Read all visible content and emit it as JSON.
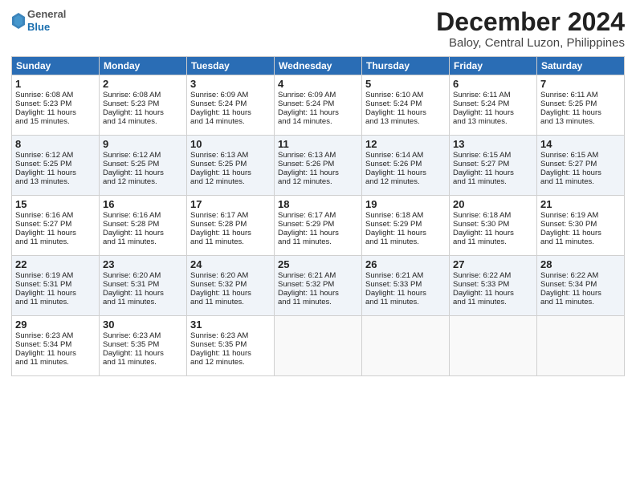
{
  "header": {
    "logo_general": "General",
    "logo_blue": "Blue",
    "month_title": "December 2024",
    "location": "Baloy, Central Luzon, Philippines"
  },
  "weekdays": [
    "Sunday",
    "Monday",
    "Tuesday",
    "Wednesday",
    "Thursday",
    "Friday",
    "Saturday"
  ],
  "rows": [
    [
      {
        "day": "1",
        "lines": [
          "Sunrise: 6:08 AM",
          "Sunset: 5:23 PM",
          "Daylight: 11 hours",
          "and 15 minutes."
        ]
      },
      {
        "day": "2",
        "lines": [
          "Sunrise: 6:08 AM",
          "Sunset: 5:23 PM",
          "Daylight: 11 hours",
          "and 14 minutes."
        ]
      },
      {
        "day": "3",
        "lines": [
          "Sunrise: 6:09 AM",
          "Sunset: 5:24 PM",
          "Daylight: 11 hours",
          "and 14 minutes."
        ]
      },
      {
        "day": "4",
        "lines": [
          "Sunrise: 6:09 AM",
          "Sunset: 5:24 PM",
          "Daylight: 11 hours",
          "and 14 minutes."
        ]
      },
      {
        "day": "5",
        "lines": [
          "Sunrise: 6:10 AM",
          "Sunset: 5:24 PM",
          "Daylight: 11 hours",
          "and 13 minutes."
        ]
      },
      {
        "day": "6",
        "lines": [
          "Sunrise: 6:11 AM",
          "Sunset: 5:24 PM",
          "Daylight: 11 hours",
          "and 13 minutes."
        ]
      },
      {
        "day": "7",
        "lines": [
          "Sunrise: 6:11 AM",
          "Sunset: 5:25 PM",
          "Daylight: 11 hours",
          "and 13 minutes."
        ]
      }
    ],
    [
      {
        "day": "8",
        "lines": [
          "Sunrise: 6:12 AM",
          "Sunset: 5:25 PM",
          "Daylight: 11 hours",
          "and 13 minutes."
        ]
      },
      {
        "day": "9",
        "lines": [
          "Sunrise: 6:12 AM",
          "Sunset: 5:25 PM",
          "Daylight: 11 hours",
          "and 12 minutes."
        ]
      },
      {
        "day": "10",
        "lines": [
          "Sunrise: 6:13 AM",
          "Sunset: 5:25 PM",
          "Daylight: 11 hours",
          "and 12 minutes."
        ]
      },
      {
        "day": "11",
        "lines": [
          "Sunrise: 6:13 AM",
          "Sunset: 5:26 PM",
          "Daylight: 11 hours",
          "and 12 minutes."
        ]
      },
      {
        "day": "12",
        "lines": [
          "Sunrise: 6:14 AM",
          "Sunset: 5:26 PM",
          "Daylight: 11 hours",
          "and 12 minutes."
        ]
      },
      {
        "day": "13",
        "lines": [
          "Sunrise: 6:15 AM",
          "Sunset: 5:27 PM",
          "Daylight: 11 hours",
          "and 11 minutes."
        ]
      },
      {
        "day": "14",
        "lines": [
          "Sunrise: 6:15 AM",
          "Sunset: 5:27 PM",
          "Daylight: 11 hours",
          "and 11 minutes."
        ]
      }
    ],
    [
      {
        "day": "15",
        "lines": [
          "Sunrise: 6:16 AM",
          "Sunset: 5:27 PM",
          "Daylight: 11 hours",
          "and 11 minutes."
        ]
      },
      {
        "day": "16",
        "lines": [
          "Sunrise: 6:16 AM",
          "Sunset: 5:28 PM",
          "Daylight: 11 hours",
          "and 11 minutes."
        ]
      },
      {
        "day": "17",
        "lines": [
          "Sunrise: 6:17 AM",
          "Sunset: 5:28 PM",
          "Daylight: 11 hours",
          "and 11 minutes."
        ]
      },
      {
        "day": "18",
        "lines": [
          "Sunrise: 6:17 AM",
          "Sunset: 5:29 PM",
          "Daylight: 11 hours",
          "and 11 minutes."
        ]
      },
      {
        "day": "19",
        "lines": [
          "Sunrise: 6:18 AM",
          "Sunset: 5:29 PM",
          "Daylight: 11 hours",
          "and 11 minutes."
        ]
      },
      {
        "day": "20",
        "lines": [
          "Sunrise: 6:18 AM",
          "Sunset: 5:30 PM",
          "Daylight: 11 hours",
          "and 11 minutes."
        ]
      },
      {
        "day": "21",
        "lines": [
          "Sunrise: 6:19 AM",
          "Sunset: 5:30 PM",
          "Daylight: 11 hours",
          "and 11 minutes."
        ]
      }
    ],
    [
      {
        "day": "22",
        "lines": [
          "Sunrise: 6:19 AM",
          "Sunset: 5:31 PM",
          "Daylight: 11 hours",
          "and 11 minutes."
        ]
      },
      {
        "day": "23",
        "lines": [
          "Sunrise: 6:20 AM",
          "Sunset: 5:31 PM",
          "Daylight: 11 hours",
          "and 11 minutes."
        ]
      },
      {
        "day": "24",
        "lines": [
          "Sunrise: 6:20 AM",
          "Sunset: 5:32 PM",
          "Daylight: 11 hours",
          "and 11 minutes."
        ]
      },
      {
        "day": "25",
        "lines": [
          "Sunrise: 6:21 AM",
          "Sunset: 5:32 PM",
          "Daylight: 11 hours",
          "and 11 minutes."
        ]
      },
      {
        "day": "26",
        "lines": [
          "Sunrise: 6:21 AM",
          "Sunset: 5:33 PM",
          "Daylight: 11 hours",
          "and 11 minutes."
        ]
      },
      {
        "day": "27",
        "lines": [
          "Sunrise: 6:22 AM",
          "Sunset: 5:33 PM",
          "Daylight: 11 hours",
          "and 11 minutes."
        ]
      },
      {
        "day": "28",
        "lines": [
          "Sunrise: 6:22 AM",
          "Sunset: 5:34 PM",
          "Daylight: 11 hours",
          "and 11 minutes."
        ]
      }
    ],
    [
      {
        "day": "29",
        "lines": [
          "Sunrise: 6:23 AM",
          "Sunset: 5:34 PM",
          "Daylight: 11 hours",
          "and 11 minutes."
        ]
      },
      {
        "day": "30",
        "lines": [
          "Sunrise: 6:23 AM",
          "Sunset: 5:35 PM",
          "Daylight: 11 hours",
          "and 11 minutes."
        ]
      },
      {
        "day": "31",
        "lines": [
          "Sunrise: 6:23 AM",
          "Sunset: 5:35 PM",
          "Daylight: 11 hours",
          "and 12 minutes."
        ]
      },
      null,
      null,
      null,
      null
    ]
  ]
}
